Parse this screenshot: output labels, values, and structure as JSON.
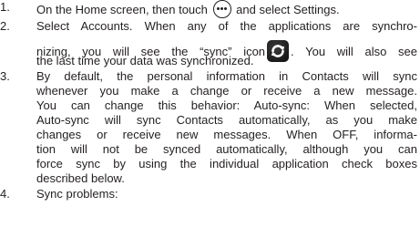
{
  "steps": [
    {
      "number": "1.",
      "line1_before": "On the Home screen, then touch",
      "line1_after": "and select Settings.",
      "menu_icon": "menu-dots-icon"
    },
    {
      "number": "2.",
      "line1": "Select Accounts. When any of the applications are synchro-",
      "line2_before": "nizing, you will see the “sync” icon",
      "line2_after": ". You will also see",
      "line3": "the last time your data was synchronized.",
      "sync_icon": "sync-icon"
    },
    {
      "number": "3.",
      "lines": [
        "By default, the personal information in Contacts will sync",
        "whenever you make a change or receive a new message.",
        "You can change this behavior: Auto-sync: When selected,",
        "Auto-sync will sync Contacts automatically, as you make",
        "changes or receive new messages. When OFF, informa-",
        "tion will not be synced automatically, although you can",
        "force sync by using the individual application check boxes",
        "described below."
      ]
    },
    {
      "number": "4.",
      "line1": "Sync problems:"
    }
  ],
  "colors": {
    "text": "#231f20",
    "sync_icon_bg": "#111111",
    "sync_arrow": "#ffffff"
  }
}
